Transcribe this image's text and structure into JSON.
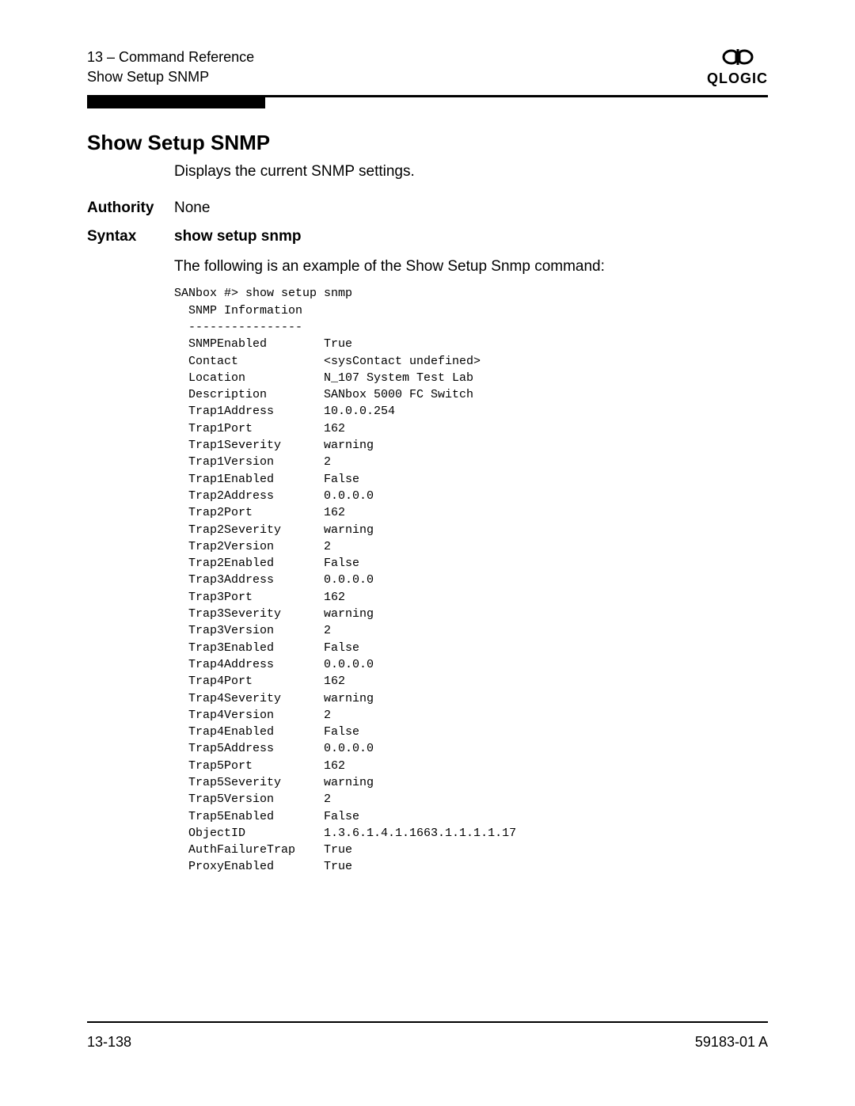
{
  "header": {
    "line1": "13 – Command Reference",
    "line2": "Show Setup SNMP",
    "logo_text": "QLOGIC"
  },
  "title": "Show Setup SNMP",
  "description": "Displays the current SNMP settings.",
  "authority": {
    "label": "Authority",
    "value": "None"
  },
  "syntax": {
    "label": "Syntax",
    "command": "show setup snmp",
    "intro": "The following is an example of the Show Setup Snmp command:",
    "cli": "SANbox #> show setup snmp\n  SNMP Information\n  ----------------\n  SNMPEnabled        True\n  Contact            <sysContact undefined>\n  Location           N_107 System Test Lab\n  Description        SANbox 5000 FC Switch\n  Trap1Address       10.0.0.254\n  Trap1Port          162\n  Trap1Severity      warning\n  Trap1Version       2\n  Trap1Enabled       False\n  Trap2Address       0.0.0.0\n  Trap2Port          162\n  Trap2Severity      warning\n  Trap2Version       2\n  Trap2Enabled       False\n  Trap3Address       0.0.0.0\n  Trap3Port          162\n  Trap3Severity      warning\n  Trap3Version       2\n  Trap3Enabled       False\n  Trap4Address       0.0.0.0\n  Trap4Port          162\n  Trap4Severity      warning\n  Trap4Version       2\n  Trap4Enabled       False\n  Trap5Address       0.0.0.0\n  Trap5Port          162\n  Trap5Severity      warning\n  Trap5Version       2\n  Trap5Enabled       False\n  ObjectID           1.3.6.1.4.1.1663.1.1.1.1.17\n  AuthFailureTrap    True\n  ProxyEnabled       True"
  },
  "footer": {
    "page": "13-138",
    "doc": "59183-01 A"
  }
}
